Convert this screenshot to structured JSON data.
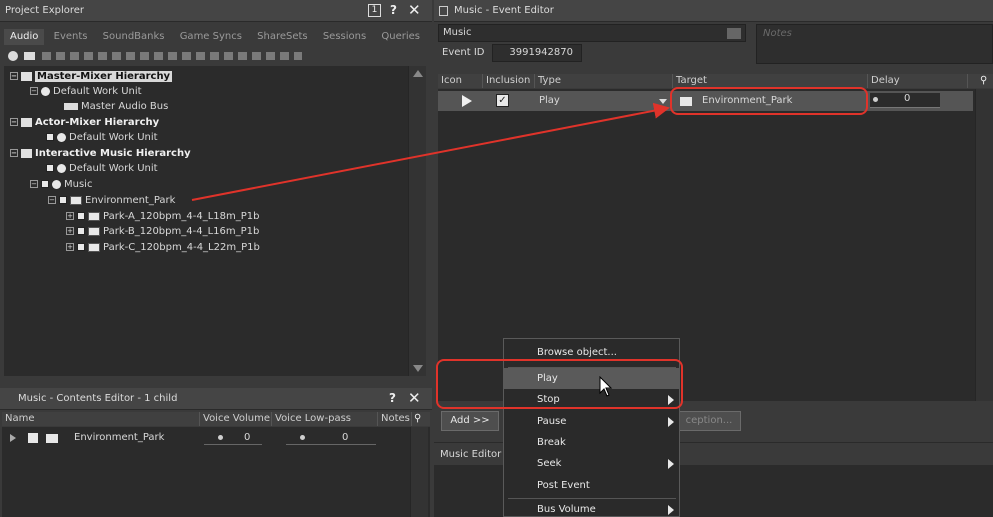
{
  "project_explorer": {
    "title": "Project Explorer",
    "tabs": [
      "Audio",
      "Events",
      "SoundBanks",
      "Game Syncs",
      "ShareSets",
      "Sessions",
      "Queries"
    ],
    "active_tab": "Audio",
    "tree": [
      {
        "label": "Master-Mixer Hierarchy",
        "bold": true,
        "selected": true
      },
      {
        "label": "Default Work Unit"
      },
      {
        "label": "Master Audio Bus"
      },
      {
        "label": "Actor-Mixer Hierarchy",
        "bold": true
      },
      {
        "label": "Default Work Unit"
      },
      {
        "label": "Interactive Music Hierarchy",
        "bold": true
      },
      {
        "label": "Default Work Unit"
      },
      {
        "label": "Music"
      },
      {
        "label": "Environment_Park"
      },
      {
        "label": "Park-A_120bpm_4-4_L18m_P1b"
      },
      {
        "label": "Park-B_120bpm_4-4_L16m_P1b"
      },
      {
        "label": "Park-C_120bpm_4-4_L22m_P1b"
      }
    ]
  },
  "contents_editor": {
    "title": "Music - Contents Editor - 1 child",
    "columns": [
      "Name",
      "Voice Volume",
      "Voice Low-pass Filter",
      "Notes"
    ],
    "row": {
      "name": "Environment_Park",
      "volume": "0",
      "lpf": "0"
    }
  },
  "event_editor": {
    "title": "Music - Event Editor",
    "name_value": "Music",
    "event_id_label": "Event ID",
    "event_id_value": "3991942870",
    "notes_placeholder": "Notes",
    "columns": [
      "Icon",
      "Inclusion",
      "Type",
      "Target",
      "Delay"
    ],
    "row": {
      "type": "Play",
      "target": "Environment_Park",
      "delay": "0"
    },
    "add_button": "Add >>",
    "exception_button": "ception..."
  },
  "music_editor": {
    "label": "Music Editor"
  },
  "context_menu": {
    "items": [
      {
        "label": "Browse object...",
        "submenu": false
      },
      {
        "label": "Play",
        "submenu": false,
        "highlighted": true
      },
      {
        "label": "Stop",
        "submenu": true
      },
      {
        "label": "Pause",
        "submenu": true
      },
      {
        "label": "Break",
        "submenu": false
      },
      {
        "label": "Seek",
        "submenu": true
      },
      {
        "label": "Post Event",
        "submenu": false
      },
      {
        "label": "Bus Volume",
        "submenu": true
      }
    ]
  },
  "colors": {
    "annotation_red": "#e0332a",
    "highlight": "#5a5a5a"
  }
}
